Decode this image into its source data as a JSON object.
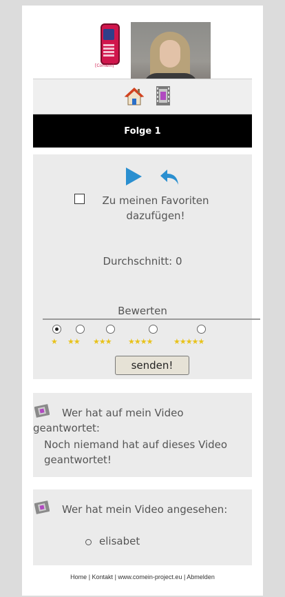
{
  "header": {
    "logo_text": "[Comein]"
  },
  "title": "Folge 1",
  "actions": {
    "favorite_label": "Zu meinen Favoriten dazufügen!",
    "favorite_checked": false
  },
  "rating": {
    "average_label": "Durchschnitt: 0",
    "rate_label": "Bewerten",
    "options": [
      {
        "stars": "★"
      },
      {
        "stars": "★★"
      },
      {
        "stars": "★★★"
      },
      {
        "stars": "★★★★"
      },
      {
        "stars": "★★★★★"
      }
    ],
    "selected_index": 0,
    "submit_label": "senden!"
  },
  "replies": {
    "title": "Wer hat auf mein Video geantwortet:",
    "empty_text": "Noch niemand hat auf dieses Video geantwortet!"
  },
  "viewers": {
    "title": "Wer hat mein Video angesehen:",
    "items": [
      "elisabet"
    ]
  },
  "footer": {
    "links": [
      "Home",
      "Kontakt",
      "www.comein-project.eu",
      "Abmelden"
    ],
    "separator": " | "
  },
  "colors": {
    "background": "#dcdcdc",
    "panel": "#ebebeb",
    "title_bar": "#000000",
    "accent_blue": "#2a8fd0",
    "star_yellow": "#e8c21a"
  }
}
